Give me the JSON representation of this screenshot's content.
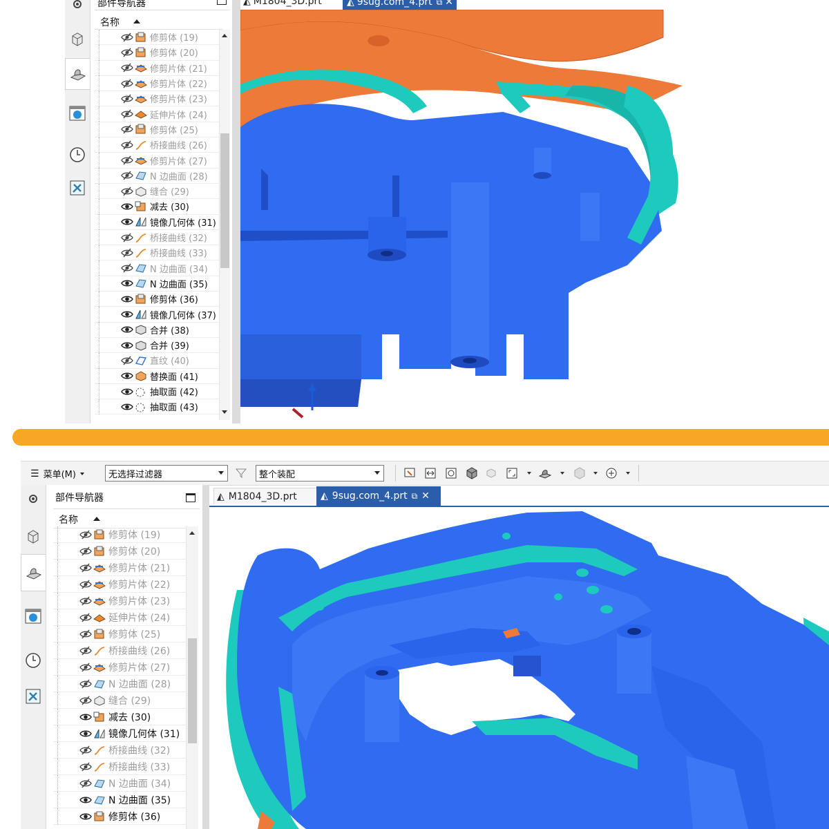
{
  "navigator_title": "部件导航器",
  "column_header": "名称",
  "filter_combo": "无选择过滤器",
  "assembly_combo": "整个装配",
  "menu_label": "菜单(M)",
  "tabs": {
    "top_first": "M1804_3D.prt",
    "top_second": "9sug.com_4.prt",
    "bottom_first": "M1804_3D.prt",
    "bottom_second": "9sug.com_4.prt"
  },
  "top_rows": [
    {
      "label": "修剪体 (19)",
      "visible": false
    },
    {
      "label": "修剪体 (20)",
      "visible": false
    },
    {
      "label": "修剪片体 (21)",
      "visible": false
    },
    {
      "label": "修剪片体 (22)",
      "visible": false
    },
    {
      "label": "修剪片体 (23)",
      "visible": false
    },
    {
      "label": "延伸片体 (24)",
      "visible": false
    },
    {
      "label": "修剪体 (25)",
      "visible": false
    },
    {
      "label": "桥接曲线 (26)",
      "visible": false
    },
    {
      "label": "修剪片体 (27)",
      "visible": false
    },
    {
      "label": "N 边曲面 (28)",
      "visible": false
    },
    {
      "label": "缝合 (29)",
      "visible": false
    },
    {
      "label": "减去 (30)",
      "visible": true
    },
    {
      "label": "镜像几何体 (31)",
      "visible": true
    },
    {
      "label": "桥接曲线 (32)",
      "visible": false
    },
    {
      "label": "桥接曲线 (33)",
      "visible": false
    },
    {
      "label": "N 边曲面 (34)",
      "visible": false
    },
    {
      "label": "N 边曲面 (35)",
      "visible": true
    },
    {
      "label": "修剪体 (36)",
      "visible": true
    },
    {
      "label": "镜像几何体 (37)",
      "visible": true
    },
    {
      "label": "合并 (38)",
      "visible": true
    },
    {
      "label": "合并 (39)",
      "visible": true
    },
    {
      "label": "直纹 (40)",
      "visible": false
    },
    {
      "label": "替换面 (41)",
      "visible": true
    },
    {
      "label": "抽取面 (42)",
      "visible": true
    },
    {
      "label": "抽取面 (43)",
      "visible": true
    }
  ],
  "bottom_rows": [
    {
      "label": "修剪体 (19)",
      "visible": false
    },
    {
      "label": "修剪体 (20)",
      "visible": false
    },
    {
      "label": "修剪片体 (21)",
      "visible": false
    },
    {
      "label": "修剪片体 (22)",
      "visible": false
    },
    {
      "label": "修剪片体 (23)",
      "visible": false
    },
    {
      "label": "延伸片体 (24)",
      "visible": false
    },
    {
      "label": "修剪体 (25)",
      "visible": false
    },
    {
      "label": "桥接曲线 (26)",
      "visible": false
    },
    {
      "label": "修剪片体 (27)",
      "visible": false
    },
    {
      "label": "N 边曲面 (28)",
      "visible": false
    },
    {
      "label": "缝合 (29)",
      "visible": false
    },
    {
      "label": "减去 (30)",
      "visible": true
    },
    {
      "label": "镜像几何体 (31)",
      "visible": true
    },
    {
      "label": "桥接曲线 (32)",
      "visible": false
    },
    {
      "label": "桥接曲线 (33)",
      "visible": false
    },
    {
      "label": "N 边曲面 (34)",
      "visible": false
    },
    {
      "label": "N 边曲面 (35)",
      "visible": true
    },
    {
      "label": "修剪体 (36)",
      "visible": true
    }
  ],
  "colors": {
    "model_blue": "#2f6cf0",
    "model_teal": "#1ec9bd",
    "model_orange": "#ee7a3a",
    "divider_orange": "#f7a626",
    "tab_active": "#2a5ea8"
  },
  "row_icon_names": [
    "trim-body-icon",
    "trim-body-icon",
    "trim-sheet-icon",
    "trim-sheet-icon",
    "trim-sheet-icon",
    "extend-sheet-icon",
    "trim-body-icon",
    "bridge-curve-icon",
    "trim-sheet-icon",
    "n-sided-surface-icon",
    "sew-icon",
    "subtract-icon",
    "mirror-geometry-icon",
    "bridge-curve-icon",
    "bridge-curve-icon",
    "n-sided-surface-icon",
    "n-sided-surface-icon",
    "trim-body-icon",
    "mirror-geometry-icon",
    "unite-icon",
    "unite-icon",
    "ruled-icon",
    "replace-face-icon",
    "extract-face-icon",
    "extract-face-icon"
  ]
}
